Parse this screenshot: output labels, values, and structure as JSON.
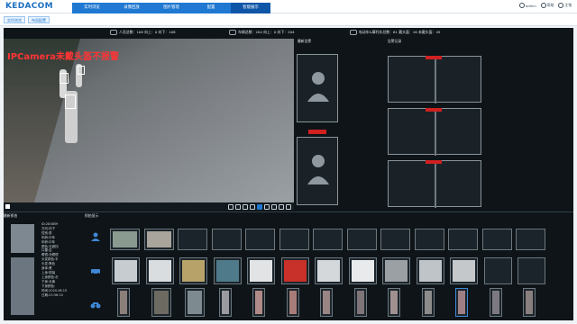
{
  "brand": {
    "logo": "KEDACOM"
  },
  "nav": {
    "items": [
      "实时浏览",
      "录像回放",
      "图片管理",
      "配置",
      "智能展示"
    ],
    "active": "智能展示"
  },
  "top_right": {
    "user": "admin",
    "help": "帮助",
    "logout": "注销"
  },
  "subtabs": [
    "实时浏览",
    "布局配置"
  ],
  "stats": {
    "person": "人员总数：108 向上：0 向下：108",
    "vehicle": "车辆总数：204 向上：0 向下：204",
    "nonmotor": "电动车&摩托车总数：61 戴头盔：16 未戴头盔：45"
  },
  "video": {
    "osd": "IPCamera未戴头盔不报警"
  },
  "panels": {
    "latest_alarm": "最新告警",
    "alarm_record": "告警记录",
    "latest_capture": "最新抓拍",
    "struct_show": "抓拍显示"
  },
  "capture_details": "ID:283859\n方向:向下\n性别:男\n年龄:中年\n年龄:中年\n颜色:无遮挡\n口罩:否\n眼镜:无眼镜\n头发颜色:平\n头发:黑色\n身体:黑\n上身:短袖\n上身颜色:灰\n下身:长裤\n下身颜色:\n时间:2020.06.15\n日期:23:36:10",
  "colors": {
    "nav_bg": "#1f78d1",
    "nav_active": "#0f56a8",
    "alarm_red": "#d02020",
    "panel_bg": "#0e1418"
  }
}
